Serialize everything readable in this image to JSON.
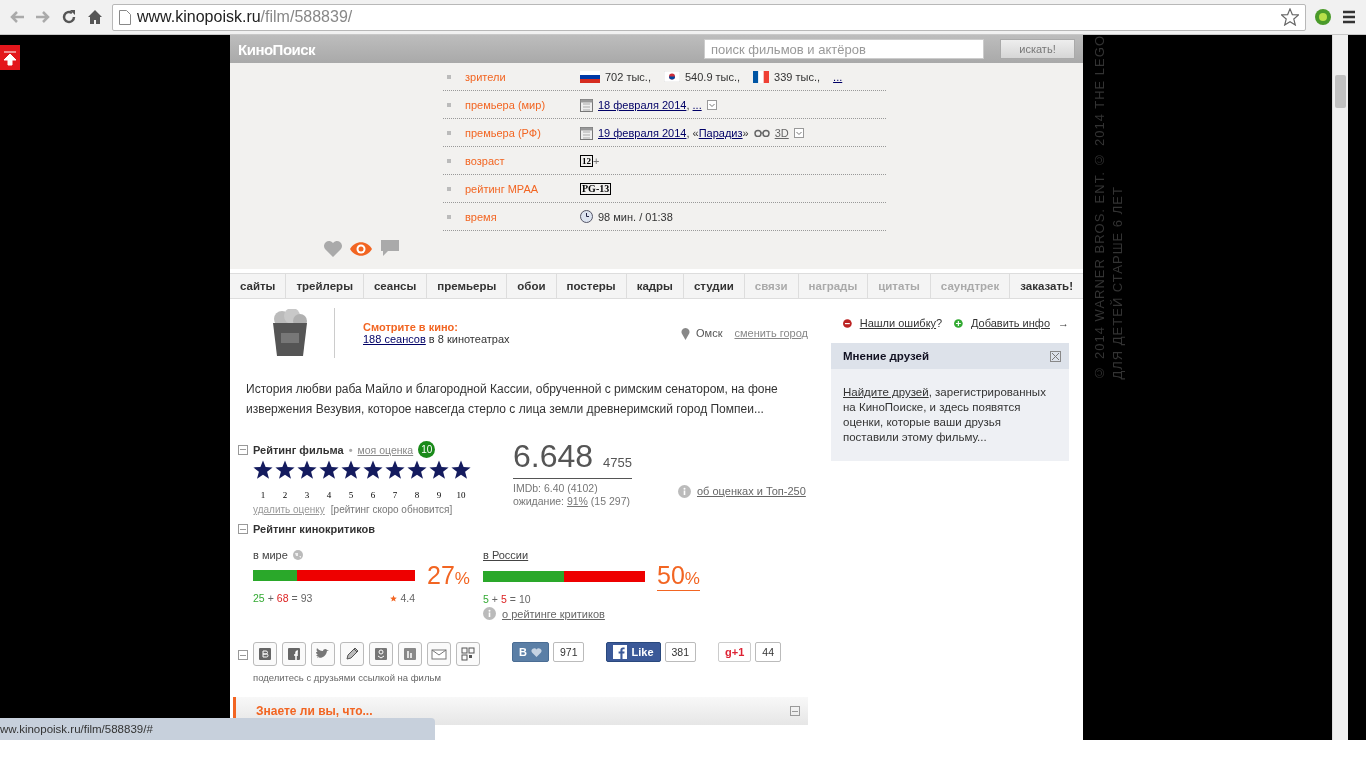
{
  "browser": {
    "url_host": "www.kinopoisk.ru",
    "url_path": "/film/588839/"
  },
  "status_url": "ww.kinopoisk.ru/film/588839/#",
  "backdrop_notice": [
    "© 2014 WARNER BROS. ENT. © 2014 THE LEGO",
    "ДЛЯ ДЕТЕЙ СТАРШЕ 6 ЛЕТ"
  ],
  "site": {
    "logo": "КиноПоиск",
    "search_placeholder": "поиск фильмов и актёров",
    "search_button": "искать!"
  },
  "info_rows": [
    {
      "label": "зрители",
      "kind": "viewers",
      "values": [
        "702 тыс.,",
        "540.9 тыс.,",
        "339 тыс.,"
      ],
      "more": "..."
    },
    {
      "label": "премьера (мир)",
      "kind": "date",
      "date": "18 февраля 2014",
      "sep": ",",
      "more": "..."
    },
    {
      "label": "премьера (РФ)",
      "kind": "date",
      "date": "19 февраля 2014",
      "sep": ", «",
      "distributor": "Парадиз",
      "close": "»",
      "format": "3D"
    },
    {
      "label": "возраст",
      "kind": "age",
      "badge": "12",
      "suffix": "+"
    },
    {
      "label": "рейтинг MPAA",
      "kind": "mpaa",
      "badge": "PG-13"
    },
    {
      "label": "время",
      "kind": "time",
      "value": "98 мин. / 01:38"
    }
  ],
  "tabs": [
    {
      "label": "сайты",
      "disabled": false
    },
    {
      "label": "трейлеры",
      "disabled": false
    },
    {
      "label": "сеансы",
      "disabled": false
    },
    {
      "label": "премьеры",
      "disabled": false
    },
    {
      "label": "обои",
      "disabled": false
    },
    {
      "label": "постеры",
      "disabled": false
    },
    {
      "label": "кадры",
      "disabled": false
    },
    {
      "label": "студии",
      "disabled": false
    },
    {
      "label": "связи",
      "disabled": true
    },
    {
      "label": "награды",
      "disabled": true
    },
    {
      "label": "цитаты",
      "disabled": true
    },
    {
      "label": "саундтрек",
      "disabled": true
    },
    {
      "label": "заказать!",
      "disabled": false
    }
  ],
  "cinema": {
    "title": "Смотрите в кино:",
    "sessions_link": "188 сеансов",
    "sessions_rest": " в 8 кинотеатрах",
    "city": "Омск",
    "change_city": "сменить город"
  },
  "description": "История любви раба Майло и благородной Кассии, обрученной с римским сенатором, на фоне извержения Везувия, которое навсегда стерло с лица земли древнеримский город Помпеи...",
  "rating": {
    "title": "Рейтинг фильма",
    "separator": "•",
    "my_rating_link": "моя оценка",
    "my_rating": "10",
    "stars": 10,
    "star_numbers": [
      "1",
      "2",
      "3",
      "4",
      "5",
      "6",
      "7",
      "8",
      "9",
      "10"
    ],
    "remove": "удалить оценку",
    "note": "[рейтинг скоро обновится]",
    "score": "6.648",
    "votes": "4755",
    "imdb": "IMDb: 6.40 (4102)",
    "expect_label": "ожидание:",
    "expect_link": "91%",
    "expect_count": "(15 297)",
    "about_link": "об оценках и Топ-250"
  },
  "critics": {
    "title": "Рейтинг кинокритиков",
    "about_link": "о рейтинге критиков",
    "groups": [
      {
        "label": "в мире",
        "kind": "world",
        "level": 0.27,
        "percent": "27",
        "sign": "%",
        "formula": [
          "25",
          "+",
          "68",
          "=",
          "93"
        ],
        "avg": "4.4"
      },
      {
        "label": "в России",
        "kind": "russia",
        "level": 0.5,
        "percent": "50",
        "sign": "%",
        "formula": [
          "5",
          "+",
          "5",
          "=",
          "10"
        ]
      }
    ]
  },
  "share": {
    "caption": "поделитесь с друзьями ссылкой на фильм",
    "counters": [
      {
        "kind": "vk",
        "label": "В",
        "count": "971"
      },
      {
        "kind": "facebook",
        "label": "Like",
        "count": "381"
      },
      {
        "kind": "gplus",
        "label": "g+1",
        "count": "44"
      }
    ]
  },
  "did_you_know": "Знаете ли вы, что...",
  "sidebar": {
    "report_link": "Нашли ошибку",
    "report_suffix": "?",
    "add_link": "Добавить инфо",
    "add_arrow": "→",
    "friends": {
      "title": "Мнение друзей",
      "link": "Найдите друзей",
      "text": ", зарегистрированных на КиноПоиске, и здесь появятся оценки, которые ваши друзья поставили этому фильму..."
    }
  }
}
